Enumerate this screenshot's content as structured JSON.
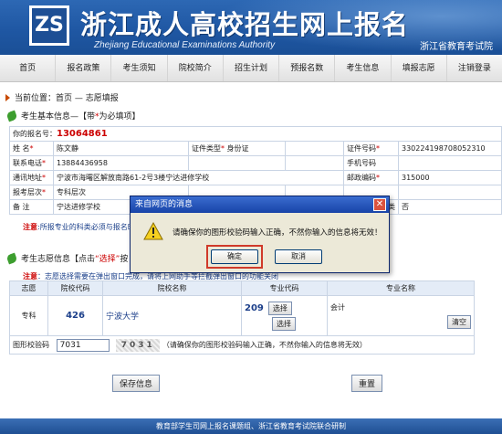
{
  "header": {
    "logo_text": "ZS",
    "title": "浙江成人高校招生网上报名",
    "subtitle": "Zhejiang Educational Examinations Authority",
    "dept": "浙江省教育考试院"
  },
  "nav": [
    "首页",
    "报名政策",
    "考生须知",
    "院校简介",
    "招生计划",
    "预报名数",
    "考生信息",
    "填报志愿",
    "注销登录"
  ],
  "breadcrumb": "当前位置：首页 — 志愿填报",
  "basic_section": {
    "title_a": "考生基本信息—【带",
    "title_req": "*",
    "title_b": "为必填项】"
  },
  "basic": {
    "reg_label": "你的报名号：",
    "reg_no": "13064861",
    "name_label": "姓 名",
    "name": "陈文静",
    "idtype_label": "证件类型",
    "idtype": "身份证",
    "idno_label": "证件号码",
    "idno": "330224198708052310",
    "phone_label": "联系电话",
    "phone": "13884436958",
    "mobile_label": "手机号码",
    "addr_label": "通讯地址",
    "addr": "宁波市海曙区解放南路61-2号3楼宁达进修学校",
    "zip_label": "邮政编码",
    "zip": "315000",
    "level_label": "报考层次",
    "level": "专科层次",
    "remark_label": "备 注",
    "remark": "宁达进修学校",
    "extra_label": "类",
    "extra_value": "否"
  },
  "sub_note": {
    "prefix": "注意",
    "text": "所报专业的科类必须与报名时"
  },
  "choice_section": {
    "title_a": "考生志愿信息【点击",
    "title_b": "“选择”",
    "title_c": "按"
  },
  "note": {
    "prefix": "注意",
    "text": "志愿选择需要在弹出窗口完成，请将上网助手等拦截弹出窗口的功能关闭"
  },
  "choice_table": {
    "headers": [
      "志愿",
      "院校代码",
      "院校名称",
      "专业代码",
      "专业名称"
    ],
    "row_label": "专科",
    "school_code": "426",
    "school_name": "宁波大学",
    "major_code": "209",
    "select_btn": "选择",
    "major_name": "会计",
    "clear_btn": "清空",
    "captcha_label": "图形校验码",
    "captcha_value": "7031",
    "captcha_img_text": "7031",
    "captcha_hint": "（请确保你的图形校验码输入正确，不然你输入的信息将无效）"
  },
  "buttons": {
    "save": "保存信息",
    "reset": "重置"
  },
  "footer": "教育部学生司网上报名课题组、浙江省教育考试院联合研制",
  "dialog": {
    "title": "来自网页的消息",
    "close": "✕",
    "message": "请确保你的图形校验码输入正确，不然你输入的信息将无效！",
    "ok": "确定",
    "cancel": "取消"
  },
  "colors": {
    "banner": "#2d68b4",
    "accent_red": "#cc0000",
    "dialog_title": "#1844a8"
  }
}
